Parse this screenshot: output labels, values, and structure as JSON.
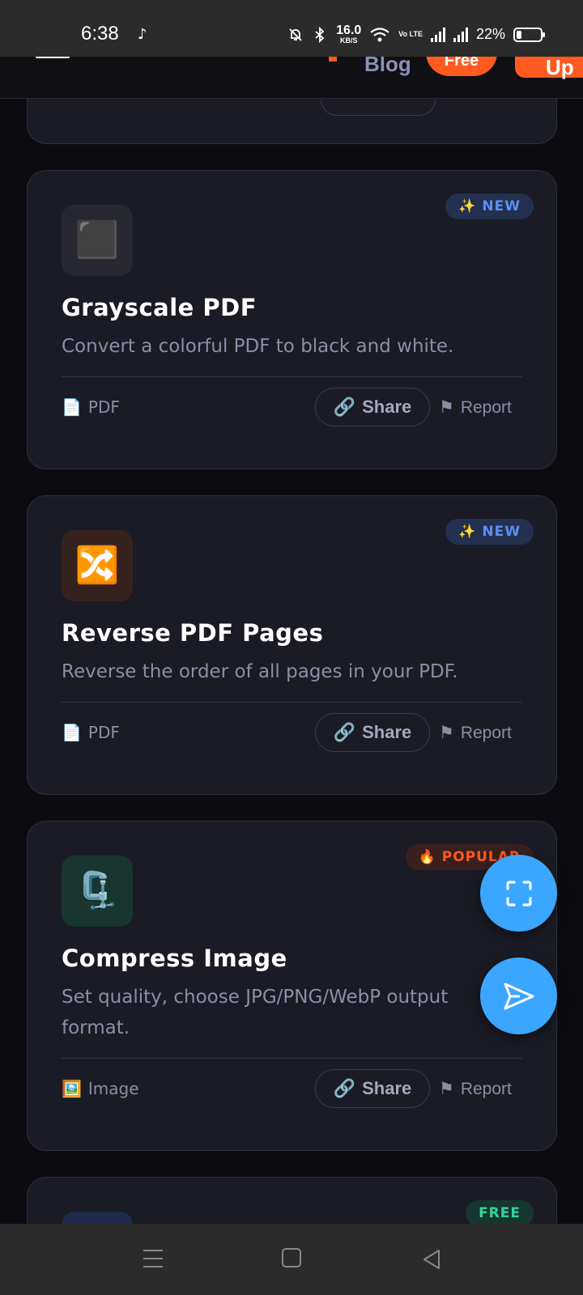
{
  "status_bar": {
    "time": "6:38",
    "speed_value": "16.0",
    "speed_unit": "KB/S",
    "volte": "Vo LTE",
    "battery": "22%"
  },
  "header": {
    "blog": "Blog",
    "free_button": "Free",
    "signup_button": "Up"
  },
  "cards": [
    {
      "badge": "✨ NEW",
      "icon": "⬛",
      "title": "Grayscale PDF",
      "description": "Convert a colorful PDF to black and white.",
      "category_icon": "📄",
      "category": "PDF",
      "share": "Share",
      "report": "Report"
    },
    {
      "badge": "✨ NEW",
      "icon": "🔀",
      "title": "Reverse PDF Pages",
      "description": "Reverse the order of all pages in your PDF.",
      "category_icon": "📄",
      "category": "PDF",
      "share": "Share",
      "report": "Report"
    },
    {
      "badge": "🔥 POPULAR",
      "icon": "🗜️",
      "title": "Compress Image",
      "description": "Set quality, choose JPG/PNG/WebP output format.",
      "category_icon": "🖼️",
      "category": "Image",
      "share": "Share",
      "report": "Report"
    },
    {
      "badge": "FREE"
    }
  ],
  "icons": {
    "share": "🔗",
    "report": "⚑"
  },
  "colors": {
    "accent": "#ff5a1f",
    "fab": "#3aa6ff",
    "card_bg": "#1a1b24",
    "page_bg": "#0c0c10"
  }
}
